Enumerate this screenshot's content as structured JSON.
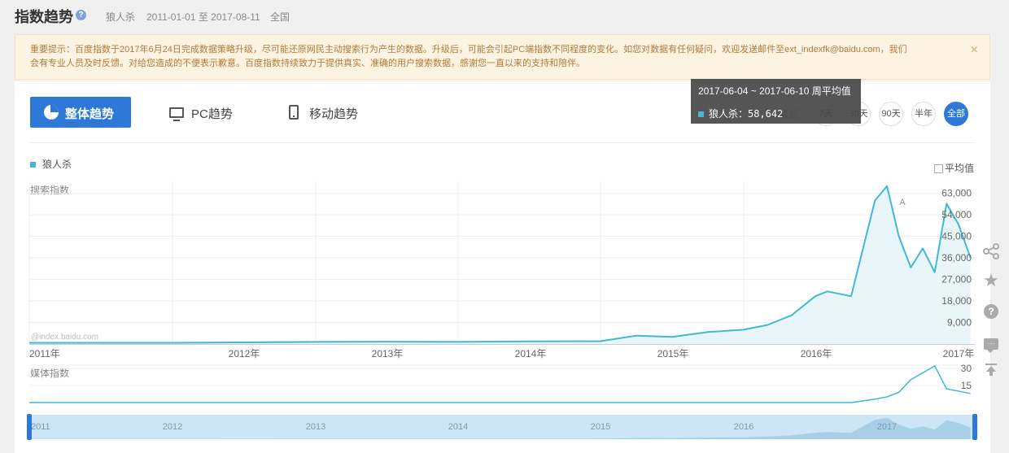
{
  "header": {
    "title": "指数趋势",
    "keyword": "狼人杀",
    "date_range": "2011-01-01 至 2017-08-11",
    "region": "全国"
  },
  "notice": {
    "line1": "重要提示：百度指数于2017年6月24日完成数据策略升级，尽可能还原网民主动搜索行为产生的数据。升级后，可能会引起PC端指数不同程度的变化。如您对数据有任何疑问，欢迎发送邮件至ext_indexfk@baidu.com，我们",
    "line2": "会有专业人员及时反馈。对给您造成的不便表示歉意。百度指数持续致力于提供真实、准确的用户搜索数据，感谢您一直以来的支持和陪伴。",
    "close": "×"
  },
  "tabs": {
    "overall": "整体趋势",
    "pc": "PC趋势",
    "mobile": "移动趋势"
  },
  "range": {
    "label": "最近",
    "options": [
      "7天",
      "30天",
      "90天",
      "半年",
      "全部"
    ],
    "active": "全部"
  },
  "legend": {
    "series": "狼人杀",
    "avg_label": "平均值"
  },
  "axis": {
    "search_title": "搜索指数",
    "media_title": "媒体指数",
    "watermark": "@index.baidu.com",
    "annotation": "A",
    "year_labels": [
      "2011年",
      "2012年",
      "2013年",
      "2014年",
      "2015年",
      "2016年",
      "2017年"
    ],
    "y_ticks": [
      "63,000",
      "54,000",
      "45,000",
      "36,000",
      "27,000",
      "18,000",
      "9,000"
    ],
    "media_ticks": [
      "30",
      "15"
    ],
    "nav_years": [
      "2011",
      "2012",
      "2013",
      "2014",
      "2015",
      "2016",
      "2017"
    ]
  },
  "tooltip": {
    "title": "2017-06-04 ~ 2017-06-10 周平均值",
    "row": "狼人杀：58,642"
  },
  "colors": {
    "accent": "#2d79d8",
    "line": "#41b8d4"
  },
  "chart_data": [
    {
      "type": "area",
      "title": "",
      "ylabel": "搜索指数",
      "ylim": [
        0,
        68000
      ],
      "x": [
        "2011-01",
        "2012-01",
        "2013-01",
        "2013-07",
        "2014-01",
        "2014-07",
        "2015-01",
        "2015-04",
        "2015-07",
        "2015-10",
        "2016-01",
        "2016-03",
        "2016-05",
        "2016-07",
        "2016-08",
        "2016-10",
        "2016-12",
        "2017-01",
        "2017-02",
        "2017-03",
        "2017-04",
        "2017-05",
        "2017-06",
        "2017-07",
        "2017-08"
      ],
      "series": [
        {
          "name": "狼人杀",
          "values": [
            500,
            500,
            900,
            1000,
            900,
            1100,
            1200,
            3500,
            3000,
            5000,
            6000,
            8000,
            12000,
            20000,
            22000,
            20000,
            60000,
            66000,
            45000,
            32000,
            40000,
            30000,
            58642,
            50000,
            36000
          ]
        }
      ]
    },
    {
      "type": "line",
      "title": "",
      "ylabel": "媒体指数",
      "ylim": [
        0,
        32
      ],
      "x": [
        "2011-01",
        "2016-10",
        "2016-12",
        "2017-01",
        "2017-02",
        "2017-03",
        "2017-05",
        "2017-06",
        "2017-08"
      ],
      "series": [
        {
          "name": "狼人杀",
          "values": [
            0,
            0,
            3,
            5,
            9,
            20,
            32,
            12,
            8
          ]
        }
      ]
    }
  ]
}
